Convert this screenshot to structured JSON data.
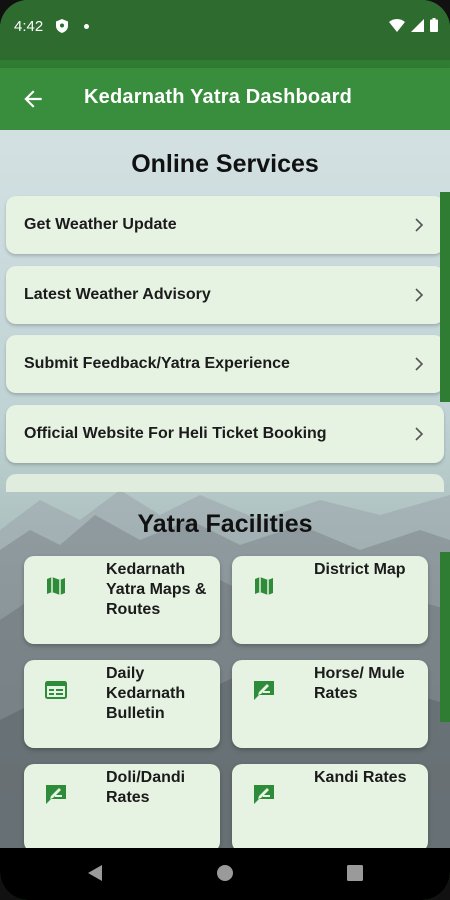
{
  "status_bar": {
    "time": "4:42"
  },
  "app_bar": {
    "title": "Kedarnath Yatra Dashboard"
  },
  "online_services": {
    "heading": "Online Services",
    "items": [
      {
        "label": "Get Weather Update"
      },
      {
        "label": "Latest Weather Advisory"
      },
      {
        "label": "Submit Feedback/Yatra Experience"
      },
      {
        "label": "Official Website For Heli Ticket Booking"
      }
    ]
  },
  "yatra_facilities": {
    "heading": "Yatra Facilities",
    "cards": [
      {
        "label": "Kedarnath Yatra Maps & Routes",
        "icon": "map-icon"
      },
      {
        "label": "District Map",
        "icon": "map-icon"
      },
      {
        "label": "Daily Kedarnath Bulletin",
        "icon": "bulletin-icon"
      },
      {
        "label": "Horse/ Mule Rates",
        "icon": "rates-icon"
      },
      {
        "label": "Doli/Dandi Rates",
        "icon": "rates-icon"
      },
      {
        "label": "Kandi Rates",
        "icon": "rates-icon"
      }
    ]
  },
  "colors": {
    "primary": "#388e3c",
    "status_bar": "#2e6b2f",
    "card_bg": "#e6f2e2",
    "icon_green": "#2e8b3a"
  }
}
